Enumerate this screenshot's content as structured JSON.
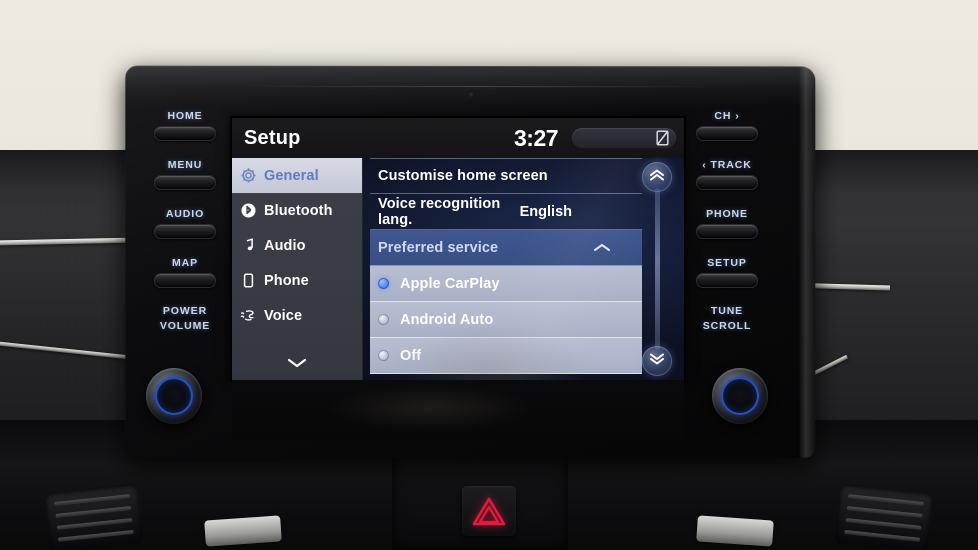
{
  "status": {
    "title": "Setup",
    "clock": "3:27",
    "signal_icon": "no-signal-icon"
  },
  "sidebar": {
    "items": [
      {
        "label": "General",
        "icon": "gear-icon",
        "selected": true
      },
      {
        "label": "Bluetooth",
        "icon": "bluetooth-icon",
        "selected": false
      },
      {
        "label": "Audio",
        "icon": "music-note-icon",
        "selected": false
      },
      {
        "label": "Phone",
        "icon": "phone-icon",
        "selected": false
      },
      {
        "label": "Voice",
        "icon": "voice-icon",
        "selected": false
      }
    ],
    "more_icon": "chevron-down-icon"
  },
  "list": {
    "rows": [
      {
        "label": "Customise home screen",
        "value": ""
      },
      {
        "label": "Voice recognition lang.",
        "value": "English"
      }
    ],
    "section": {
      "label": "Preferred service",
      "collapse_icon": "chevron-up-icon"
    },
    "options": [
      {
        "label": "Apple CarPlay",
        "selected": true
      },
      {
        "label": "Android Auto",
        "selected": false
      },
      {
        "label": "Off",
        "selected": false
      }
    ]
  },
  "scroll": {
    "up_icon": "double-chevron-up-icon",
    "down_icon": "double-chevron-down-icon"
  },
  "hardware": {
    "left_buttons": [
      {
        "label": "HOME"
      },
      {
        "label": "MENU"
      },
      {
        "label": "AUDIO"
      },
      {
        "label": "MAP"
      }
    ],
    "left_knob_label_line1": "POWER",
    "left_knob_label_line2": "VOLUME",
    "right_buttons": [
      {
        "label": "CH ›"
      },
      {
        "label": "‹ TRACK"
      },
      {
        "label": "PHONE"
      },
      {
        "label": "SETUP"
      }
    ],
    "right_knob_label_line1": "TUNE",
    "right_knob_label_line2": "SCROLL",
    "hazard_icon": "hazard-triangle-icon"
  },
  "colors": {
    "accent_blue": "#5d8ef0",
    "section_blue": "#3f5690",
    "option_grey": "#b9bfd2",
    "screen_bg": "#101a33",
    "hazard_red": "#e01b3c"
  }
}
